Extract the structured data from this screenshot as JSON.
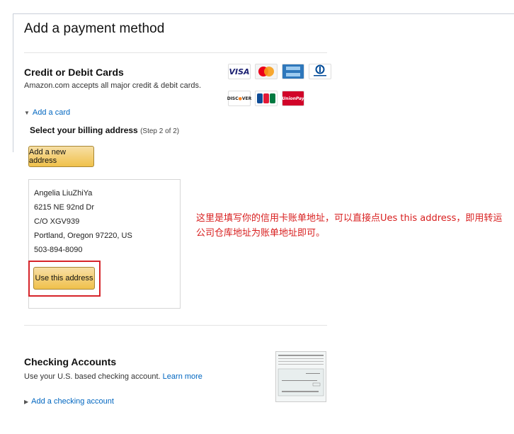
{
  "page": {
    "title": "Add a payment method"
  },
  "credit_cards": {
    "heading": "Credit or Debit Cards",
    "subtitle": "Amazon.com accepts all major credit & debit cards.",
    "logos": [
      {
        "name": "VISA",
        "color": "#1a1f71"
      },
      {
        "name": "MasterCard",
        "color": "#eb001b"
      },
      {
        "name": "AMERICAN EXPRESS",
        "color": "#2e77bb"
      },
      {
        "name": "Diners Club International",
        "color": "#004a97"
      },
      {
        "name": "DISCOVER",
        "color": "#f68121"
      },
      {
        "name": "JCB",
        "color": "#0e4c96"
      },
      {
        "name": "UnionPay 银联",
        "color": "#d10429"
      }
    ],
    "add_card_label": "Add a card",
    "step_label": "Select your billing address",
    "step_note": "(Step 2 of 2)",
    "add_address_button": "Add a new address"
  },
  "address": {
    "lines": [
      "Angelia LiuZhiYa",
      "6215 NE 92nd Dr",
      "C/O XGV939",
      "Portland, Oregon 97220, US",
      "503-894-8090"
    ],
    "use_button": "Use this address"
  },
  "annotation": {
    "text": "这里是填写你的信用卡账单地址，可以直接点Ues this address，即用转运公司仓库地址为账单地址即可。"
  },
  "checking": {
    "heading": "Checking Accounts",
    "subtitle": "Use your U.S. based checking account.",
    "learn_more": "Learn more",
    "add_label": "Add a checking account"
  },
  "colors": {
    "link": "#0066c0",
    "button": "#f0c14b",
    "highlight": "#d6242a",
    "annotation": "#d81e1e"
  }
}
